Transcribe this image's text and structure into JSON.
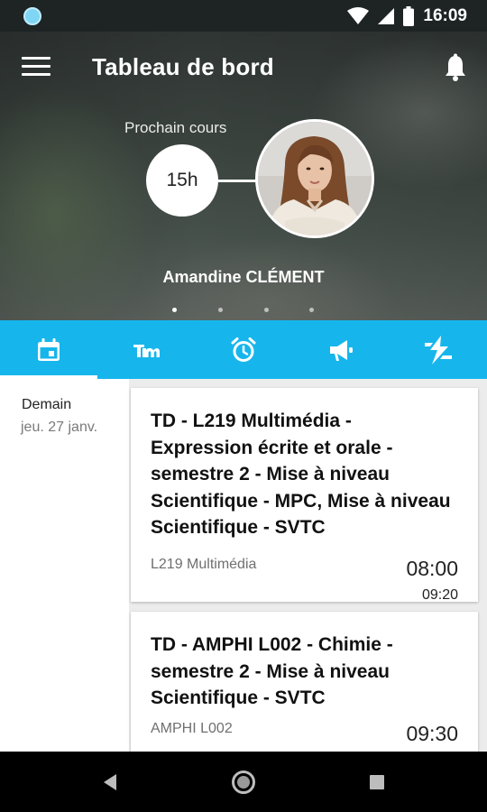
{
  "status_bar": {
    "time": "16:09"
  },
  "header": {
    "title": "Tableau de bord",
    "next_course_label": "Prochain cours",
    "next_course_time": "15h",
    "teacher_name": "Amandine CLÉMENT",
    "carousel_pages": 4,
    "carousel_active": 1
  },
  "tabs": [
    {
      "icon": "calendar-icon",
      "selected": true
    },
    {
      "icon": "grades-icon",
      "selected": false
    },
    {
      "icon": "alarm-clock-icon",
      "selected": false
    },
    {
      "icon": "megaphone-icon",
      "selected": false
    },
    {
      "icon": "lightning-icon",
      "selected": false
    }
  ],
  "schedule": {
    "day_label": "Demain",
    "day_date": "jeu. 27 janv.",
    "courses": [
      {
        "title": "TD - L219 Multimédia - Expression écrite et orale - semestre 2 - Mise à niveau Scientifique - MPC, Mise à niveau Scientifique - SVTC",
        "room": "L219 Multimédia",
        "start": "08:00",
        "end": "09:20"
      },
      {
        "title": "TD - AMPHI L002 - Chimie - semestre 2 - Mise à niveau Scientifique - SVTC",
        "room": "AMPHI L002",
        "start": "09:30",
        "end": ""
      }
    ]
  },
  "colors": {
    "accent": "#16b6ec",
    "status_bar": "#1e2424",
    "nav_bar": "#000000"
  }
}
